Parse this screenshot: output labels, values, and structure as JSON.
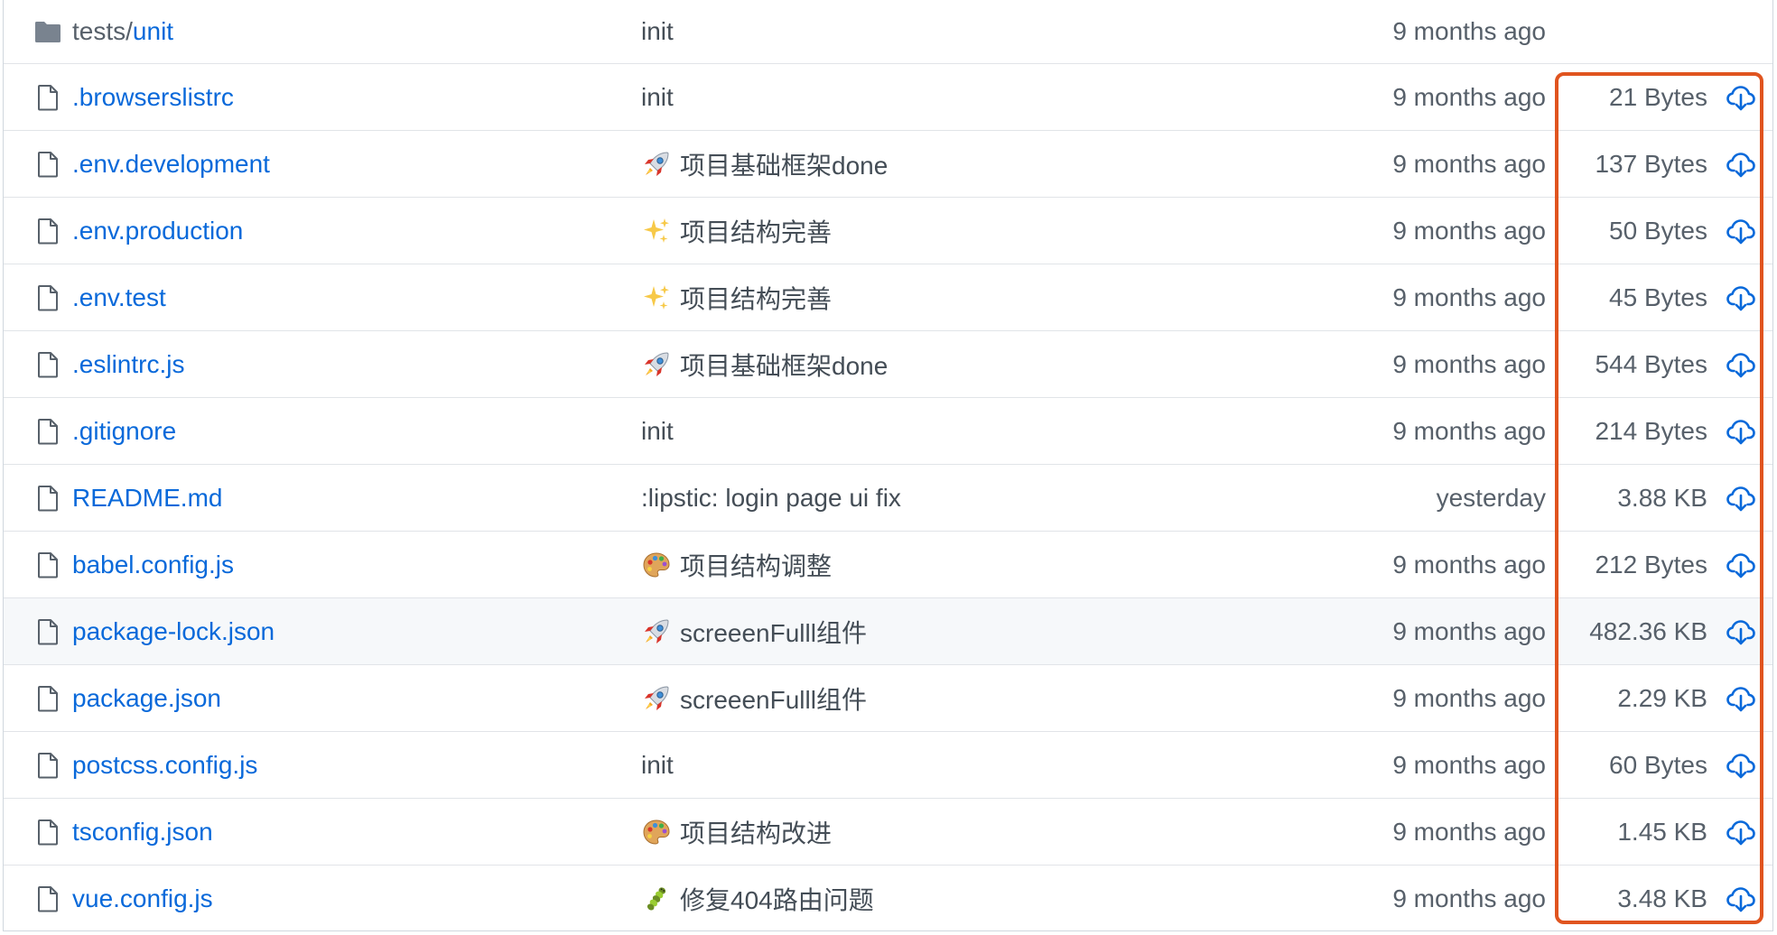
{
  "files": [
    {
      "prefix": "tests/",
      "name": "unit",
      "type": "folder",
      "message": "init",
      "emoji": "",
      "date": "9 months ago",
      "size": ""
    },
    {
      "prefix": "",
      "name": ".browserslistrc",
      "type": "file",
      "message": "init",
      "emoji": "",
      "date": "9 months ago",
      "size": "21 Bytes"
    },
    {
      "prefix": "",
      "name": ".env.development",
      "type": "file",
      "message": "项目基础框架done",
      "emoji": "rocket",
      "date": "9 months ago",
      "size": "137 Bytes"
    },
    {
      "prefix": "",
      "name": ".env.production",
      "type": "file",
      "message": "项目结构完善",
      "emoji": "sparkles",
      "date": "9 months ago",
      "size": "50 Bytes"
    },
    {
      "prefix": "",
      "name": ".env.test",
      "type": "file",
      "message": "项目结构完善",
      "emoji": "sparkles",
      "date": "9 months ago",
      "size": "45 Bytes"
    },
    {
      "prefix": "",
      "name": ".eslintrc.js",
      "type": "file",
      "message": "项目基础框架done",
      "emoji": "rocket",
      "date": "9 months ago",
      "size": "544 Bytes"
    },
    {
      "prefix": "",
      "name": ".gitignore",
      "type": "file",
      "message": "init",
      "emoji": "",
      "date": "9 months ago",
      "size": "214 Bytes"
    },
    {
      "prefix": "",
      "name": "README.md",
      "type": "file",
      "message": ":lipstic: login page ui fix",
      "emoji": "",
      "date": "yesterday",
      "size": "3.88 KB"
    },
    {
      "prefix": "",
      "name": "babel.config.js",
      "type": "file",
      "message": "项目结构调整",
      "emoji": "palette",
      "date": "9 months ago",
      "size": "212 Bytes"
    },
    {
      "prefix": "",
      "name": "package-lock.json",
      "type": "file",
      "message": "screeenFulll组件",
      "emoji": "rocket",
      "date": "9 months ago",
      "size": "482.36 KB",
      "highlighted": true
    },
    {
      "prefix": "",
      "name": "package.json",
      "type": "file",
      "message": "screeenFulll组件",
      "emoji": "rocket",
      "date": "9 months ago",
      "size": "2.29 KB"
    },
    {
      "prefix": "",
      "name": "postcss.config.js",
      "type": "file",
      "message": "init",
      "emoji": "",
      "date": "9 months ago",
      "size": "60 Bytes"
    },
    {
      "prefix": "",
      "name": "tsconfig.json",
      "type": "file",
      "message": "项目结构改进",
      "emoji": "palette",
      "date": "9 months ago",
      "size": "1.45 KB"
    },
    {
      "prefix": "",
      "name": "vue.config.js",
      "type": "file",
      "message": "修复404路由问题",
      "emoji": "bug",
      "date": "9 months ago",
      "size": "3.48 KB"
    }
  ],
  "icons": {
    "folder": "folder-icon",
    "file": "file-icon",
    "download": "cloud-download-icon"
  },
  "colors": {
    "link": "#0969da",
    "highlight_border": "#e0541f",
    "folder": "#79838f"
  }
}
